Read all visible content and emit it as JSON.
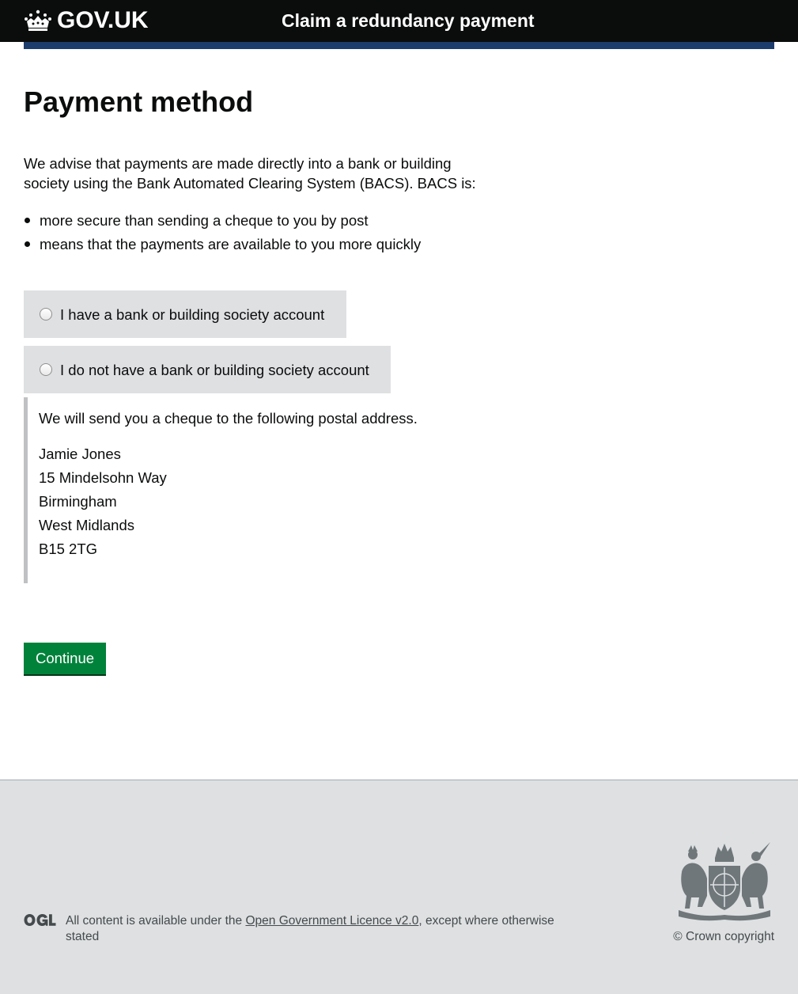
{
  "header": {
    "logo_text": "GOV.UK",
    "service_name": "Claim a redundancy payment"
  },
  "main": {
    "title": "Payment method",
    "lead": "We advise that payments are made directly into a bank or building society using the Bank Automated Clearing System (BACS). BACS is:",
    "bullets": [
      "more secure than sending a cheque to you by post",
      "means that the payments are available to you more quickly"
    ],
    "options": [
      {
        "label": "I have a bank or building society account",
        "selected": false
      },
      {
        "label": "I do not have a bank or building society account",
        "selected": false
      }
    ],
    "conditional": {
      "intro": "We will send you a cheque to the following postal address.",
      "address": [
        "Jamie Jones",
        "15 Mindelsohn Way",
        "Birmingham",
        "West Midlands",
        "B15 2TG"
      ]
    },
    "continue_label": "Continue"
  },
  "footer": {
    "ogl_logo_text": "OGL",
    "licence_prefix": "All content is available under the ",
    "licence_link": "Open Government Licence v2.0",
    "licence_suffix": ", except where otherwise stated",
    "copyright": "© Crown copyright"
  },
  "colors": {
    "header_bg": "#0b0c0c",
    "blue_bar": "#1d3c6e",
    "button_green": "#00823b",
    "radio_bg": "#dee0e2",
    "footer_bg": "#dee0e2"
  }
}
